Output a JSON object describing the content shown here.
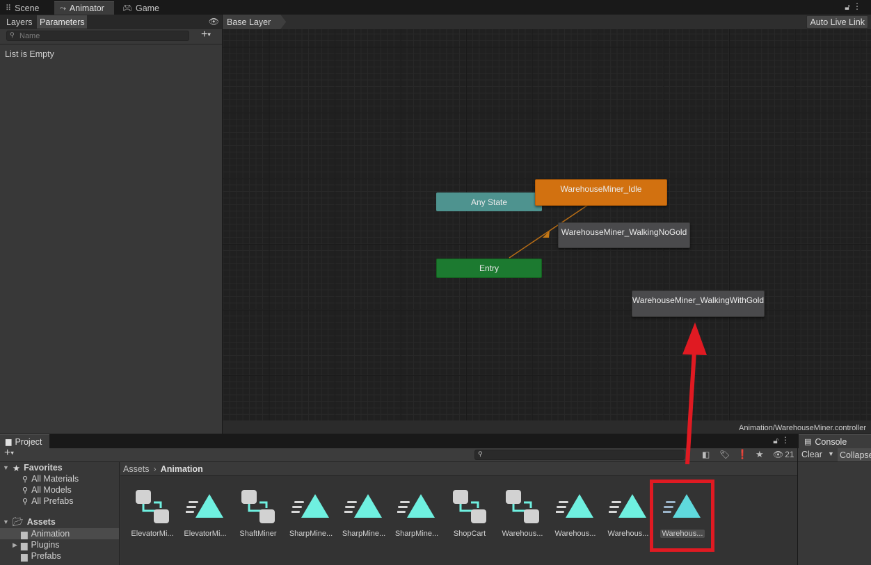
{
  "window_tabs": [
    {
      "label": "Scene",
      "icon": "scene-grid-icon",
      "active": false
    },
    {
      "label": "Animator",
      "icon": "animator-icon",
      "active": true
    },
    {
      "label": "Game",
      "icon": "gamepad-icon",
      "active": false
    }
  ],
  "left_panel": {
    "tabs": [
      "Layers",
      "Parameters"
    ],
    "selected_tab": "Parameters",
    "search_placeholder": "Name",
    "empty_text": "List is Empty"
  },
  "graph": {
    "breadcrumb": "Base Layer",
    "auto_live_link": "Auto Live Link",
    "footer_path": "Animation/WarehouseMiner.controller",
    "nodes": {
      "any_state": "Any State",
      "entry": "Entry",
      "idle": "WarehouseMiner_Idle",
      "walking_no_gold": "WarehouseMiner_WalkingNoGold",
      "walking_with_gold": "WarehouseMiner_WalkingWithGold"
    },
    "colors": {
      "default_state": "#d27110",
      "any_state": "#4e938f",
      "entry": "#1c7a30",
      "state": "#4a4a4c",
      "transition": "#b76d16"
    }
  },
  "project": {
    "tab": "Project",
    "visible_count": "21",
    "tree": {
      "favorites": "Favorites",
      "all_materials": "All Materials",
      "all_models": "All Models",
      "all_prefabs": "All Prefabs",
      "assets": "Assets",
      "animation": "Animation",
      "plugins": "Plugins",
      "prefabs": "Prefabs"
    },
    "breadcrumb": [
      "Assets",
      "Animation"
    ],
    "items": [
      {
        "label": "ElevatorMi...",
        "type": "animator-controller"
      },
      {
        "label": "ElevatorMi...",
        "type": "animation-clip"
      },
      {
        "label": "ShaftMiner",
        "type": "animator-controller"
      },
      {
        "label": "SharpMine...",
        "type": "animation-clip"
      },
      {
        "label": "SharpMine...",
        "type": "animation-clip"
      },
      {
        "label": "SharpMine...",
        "type": "animation-clip"
      },
      {
        "label": "ShopCart",
        "type": "animator-controller"
      },
      {
        "label": "Warehous...",
        "type": "animator-controller"
      },
      {
        "label": "Warehous...",
        "type": "animation-clip"
      },
      {
        "label": "Warehous...",
        "type": "animation-clip"
      },
      {
        "label": "Warehous...",
        "type": "animation-clip",
        "selected": true
      }
    ]
  },
  "console": {
    "tab": "Console",
    "clear": "Clear",
    "collapse": "Collapse"
  },
  "annotation": {
    "color": "#e01a22"
  }
}
